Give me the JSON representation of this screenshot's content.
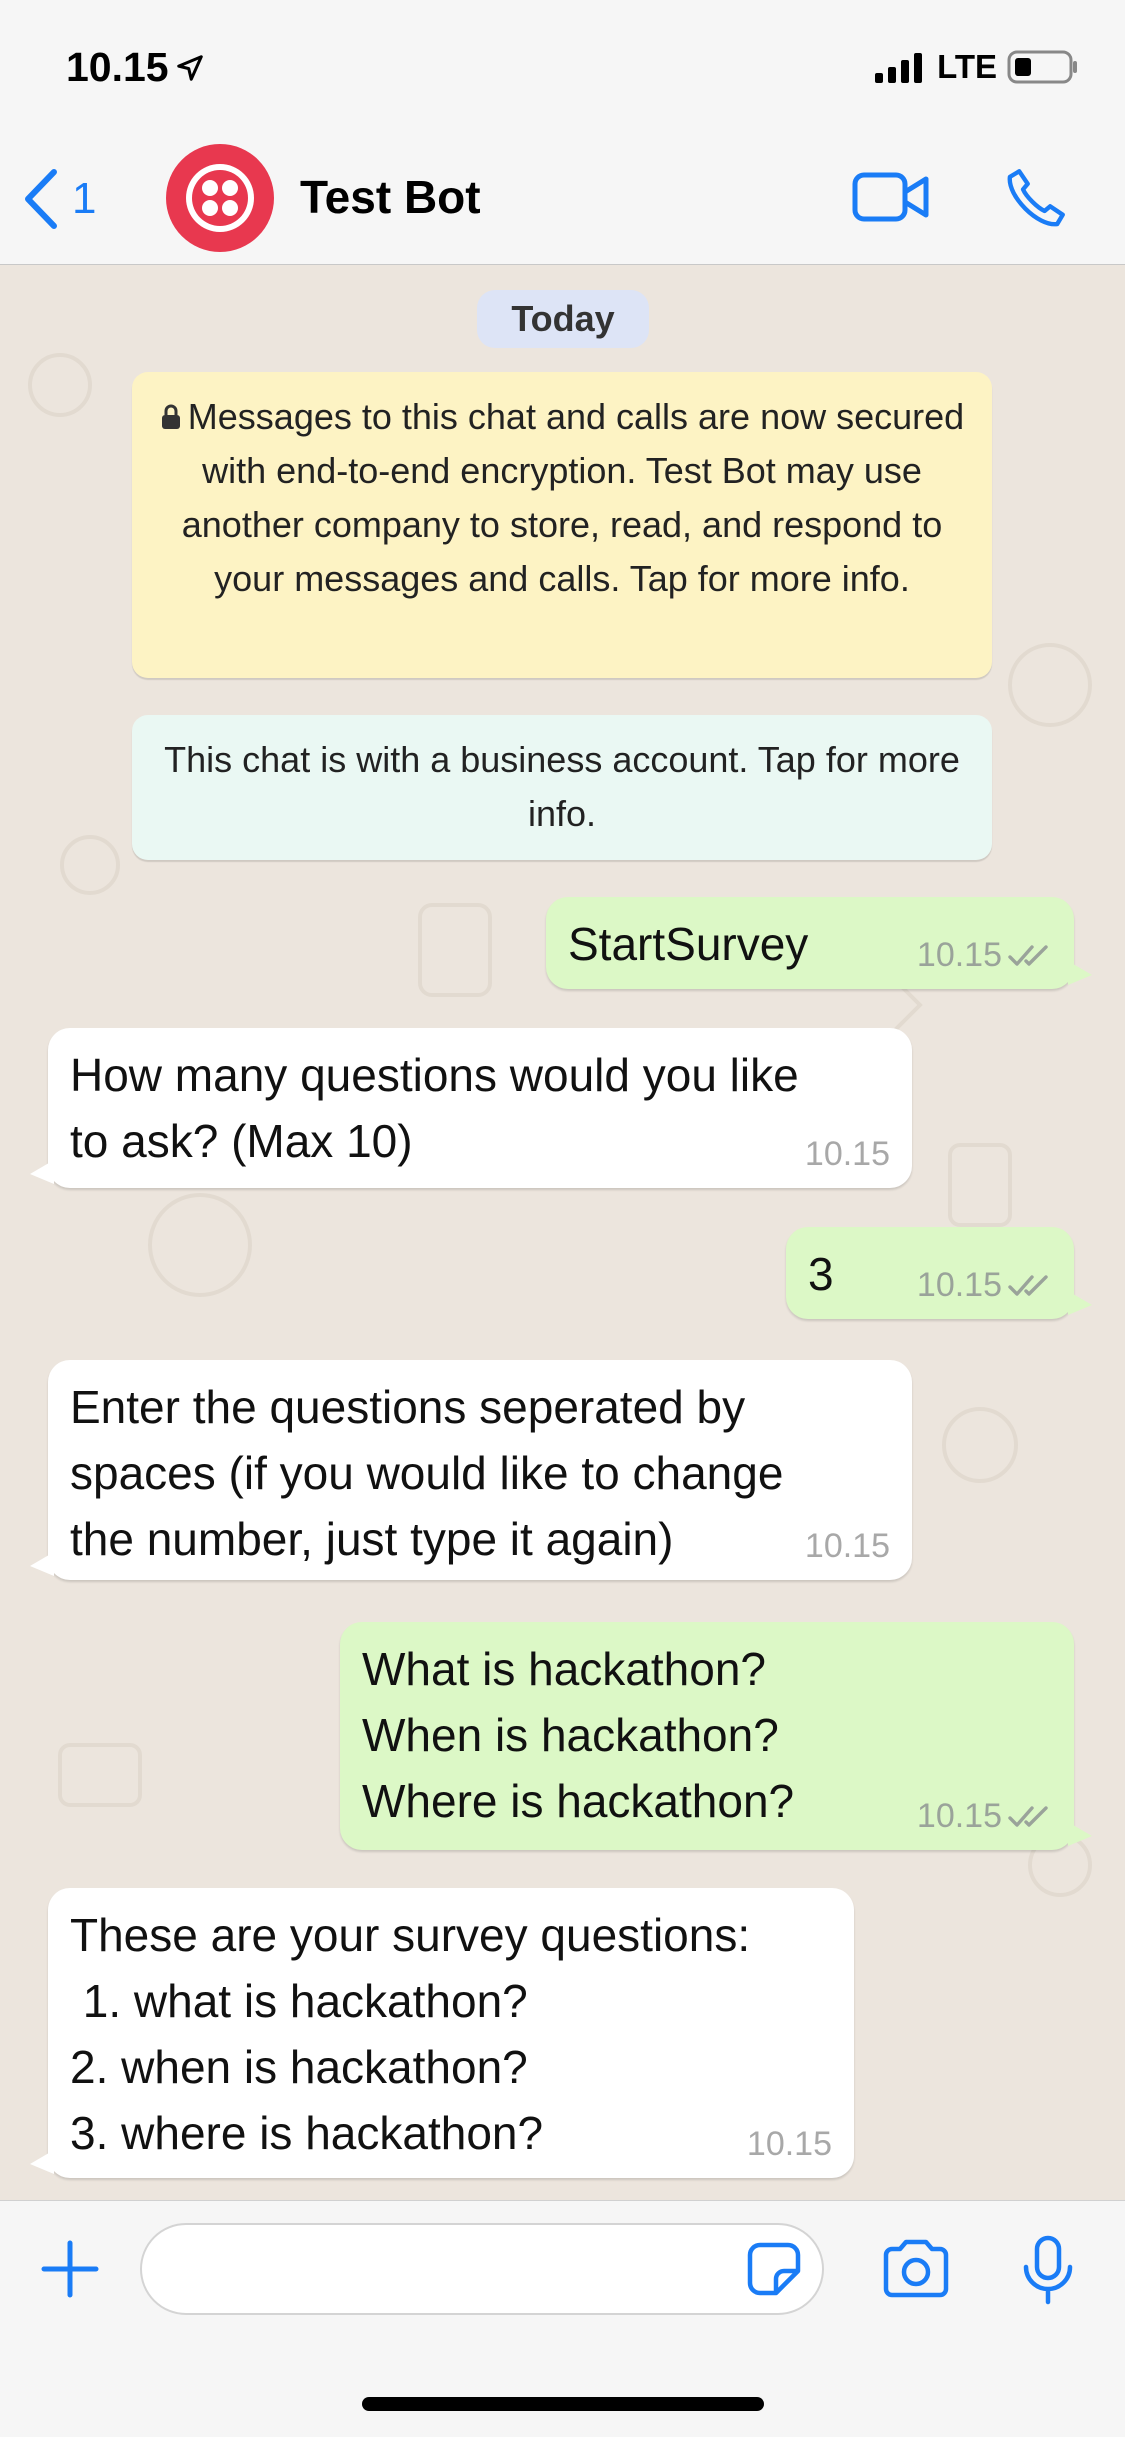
{
  "status_bar": {
    "time": "10.15",
    "carrier": "LTE",
    "icons": [
      "location-arrow-icon",
      "signal-bars-icon",
      "battery-icon"
    ]
  },
  "nav": {
    "back_count": "1",
    "contact_name": "Test Bot",
    "icons": [
      "back-chevron-icon",
      "video-call-icon",
      "phone-call-icon"
    ]
  },
  "chat": {
    "date_label": "Today",
    "encryption_notice": "Messages to this chat and calls are now secured with end-to-end encryption. Test Bot may use another company to store, read, and respond to your messages and calls. Tap for more info.",
    "business_notice": "This chat is with a business account. Tap for more info.",
    "messages": [
      {
        "direction": "outgoing",
        "text": "StartSurvey",
        "time": "10.15",
        "read": true
      },
      {
        "direction": "incoming",
        "text": "How many questions would you like\nto ask? (Max 10)",
        "time": "10.15"
      },
      {
        "direction": "outgoing",
        "text": "3",
        "time": "10.15",
        "read": true
      },
      {
        "direction": "incoming",
        "text": "Enter the questions seperated by\nspaces (if you would like to change\nthe number, just type it again)",
        "time": "10.15"
      },
      {
        "direction": "outgoing",
        "text": "What is hackathon?\nWhen is hackathon?\nWhere is hackathon?",
        "time": "10.15",
        "read": true
      },
      {
        "direction": "incoming",
        "text": "These are your survey questions:\n 1. what is hackathon?\n2. when is hackathon?\n3. where is hackathon?",
        "time": "10.15"
      }
    ]
  },
  "input_bar": {
    "placeholder": "",
    "icons": [
      "plus-icon",
      "sticker-icon",
      "camera-icon",
      "microphone-icon"
    ]
  },
  "colors": {
    "accent": "#1a7cf6",
    "outgoing_bubble": "#dcf8c6",
    "incoming_bubble": "#ffffff",
    "chat_background": "#ece5dd",
    "encryption_notice_bg": "#fdf3c4",
    "business_notice_bg": "#eaf8f3",
    "avatar_brand": "#e8384f"
  }
}
